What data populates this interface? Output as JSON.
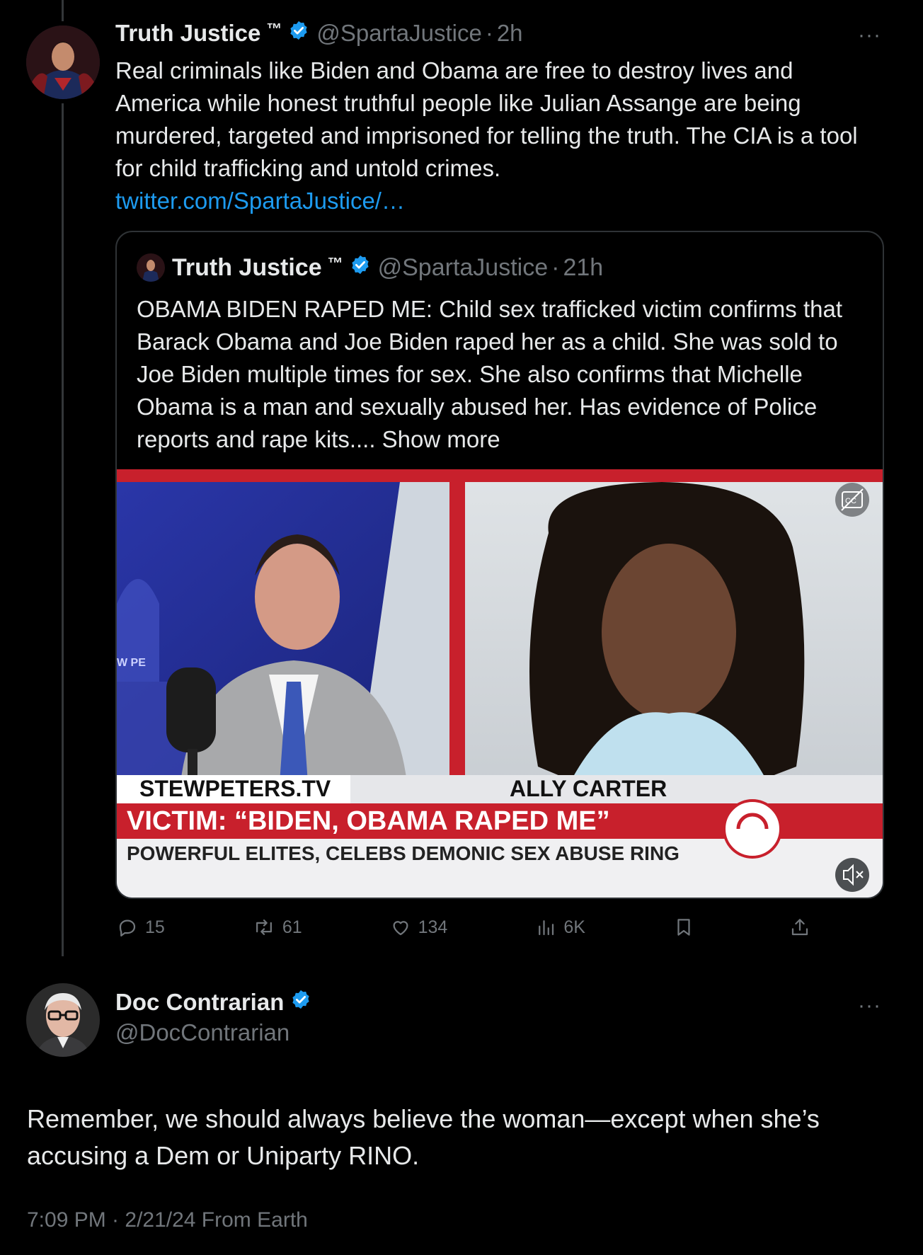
{
  "colors": {
    "background": "#000000",
    "text": "#e7e9ea",
    "secondary": "#71767b",
    "link": "#1d9bf0",
    "verified": "#1d9bf0",
    "border": "#2f3336"
  },
  "tweet": {
    "author_name": "Truth Justice",
    "author_tm": "™",
    "handle": "@SpartaJustice",
    "time": "2h",
    "separator": "·",
    "more": "···",
    "text": "Real criminals like Biden and Obama are free to destroy lives and America while honest truthful people like Julian Assange are being murdered, targeted and imprisoned for telling the truth. The CIA is a tool for child trafficking and untold crimes.",
    "link": "twitter.com/SpartaJustice/…",
    "quote": {
      "author_name": "Truth Justice",
      "author_tm": "™",
      "handle": "@SpartaJustice",
      "time": "21h",
      "separator": "·",
      "text": "OBAMA BIDEN RAPED ME: Child sex trafficked victim confirms that Barack Obama and Joe Biden raped her as a child. She was sold to Joe Biden multiple times for sex. She also confirms that Michelle Obama is a man and sexually abused her. Has evidence of Police reports and rape kits....",
      "show_more": "Show more",
      "media": {
        "brand": "STEWPETERS.TV",
        "guest": "ALLY CARTER",
        "headline": "VICTIM: “BIDEN, OBAMA RAPED ME”",
        "ticker": "POWERFUL ELITES, CELEBS DEMONIC SEX ABUSE RING",
        "left_fragment": "W PE",
        "captions_icon": "captions-icon",
        "mute_icon": "muted-speaker-icon"
      }
    },
    "actions": {
      "replies": "15",
      "reposts": "61",
      "likes": "134",
      "views": "6K"
    }
  },
  "reply": {
    "author_name": "Doc Contrarian",
    "handle": "@DocContrarian",
    "more": "···",
    "text": "Remember, we should always believe the woman—except when she’s accusing a Dem or Uniparty RINO.",
    "timestamp": "7:09 PM · 2/21/24 From Earth"
  }
}
